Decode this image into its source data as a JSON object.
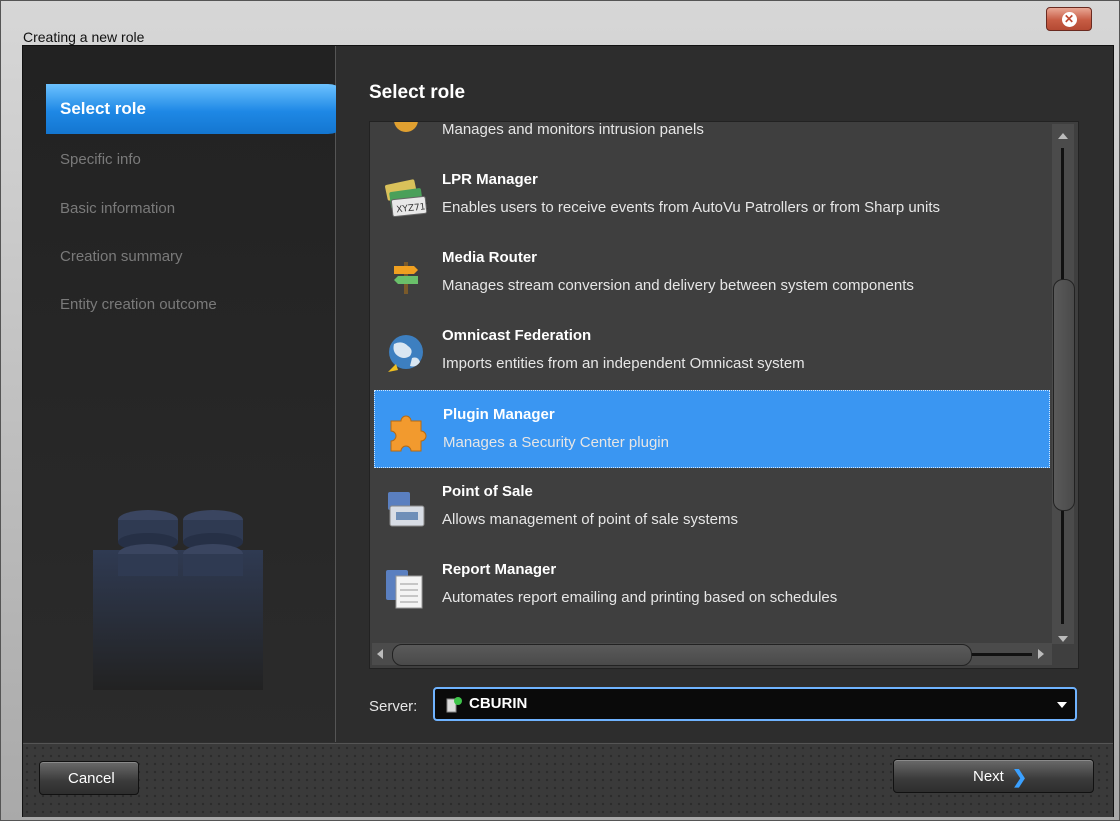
{
  "window": {
    "title": "Creating a new role"
  },
  "nav": {
    "active": "Select role",
    "steps": [
      "Specific info",
      "Basic information",
      "Creation summary",
      "Entity creation outcome"
    ]
  },
  "main": {
    "title": "Select role",
    "partial_item_desc": "Manages and monitors intrusion panels",
    "roles": [
      {
        "name": "LPR Manager",
        "desc": "Enables users to receive events from AutoVu Patrollers or from Sharp units",
        "icon": "license-plate-icon"
      },
      {
        "name": "Media Router",
        "desc": "Manages stream conversion and delivery between system components",
        "icon": "signpost-icon"
      },
      {
        "name": "Omnicast Federation",
        "desc": "Imports entities from an independent Omnicast system",
        "icon": "globe-icon"
      },
      {
        "name": "Plugin Manager",
        "desc": "Manages a Security Center plugin",
        "icon": "puzzle-piece-icon",
        "selected": true
      },
      {
        "name": "Point of Sale",
        "desc": "Allows management of point of sale systems",
        "icon": "cash-register-icon"
      },
      {
        "name": "Report Manager",
        "desc": "Automates report emailing and printing based on schedules",
        "icon": "report-icon"
      }
    ],
    "server": {
      "label": "Server:",
      "value": "CBURIN"
    }
  },
  "footer": {
    "cancel_label": "Cancel",
    "next_label": "Next"
  },
  "colors": {
    "selection": "#3a96f2",
    "active_step": "#1e88e5",
    "background": "#2d2d2d"
  }
}
